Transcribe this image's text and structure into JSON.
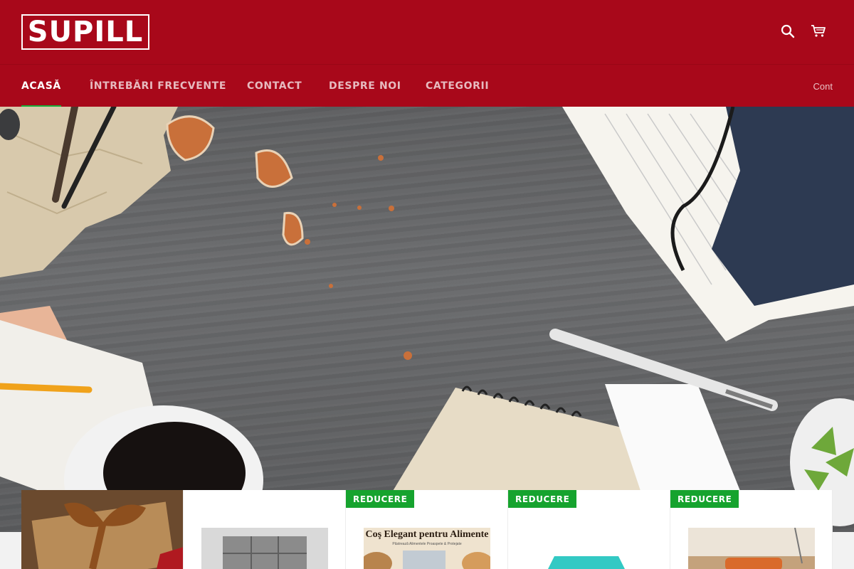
{
  "header": {
    "logo_text": "SUPILL",
    "icons": [
      "search-icon",
      "cart-icon"
    ],
    "brand_color": "#a8081a"
  },
  "nav": {
    "items": [
      {
        "label": "ACASĂ",
        "active": true
      },
      {
        "label": "ÎNTREBĂRI FRECVENTE",
        "active": false
      },
      {
        "label": "CONTACT",
        "active": false
      },
      {
        "label": "DESPRE NOI",
        "active": false
      },
      {
        "label": "CATEGORII",
        "active": false
      }
    ],
    "account_label": "Cont",
    "active_indicator_color": "#1aae3a"
  },
  "products": [
    {
      "badge": null,
      "image": "gift-box-with-ribbon"
    },
    {
      "badge": null,
      "image": "gray-storage-organizer"
    },
    {
      "badge": "REDUCERE",
      "image": "food-basket",
      "image_title": "Coş Elegant pentru Alimente",
      "image_subtitle": "Păstrează Alimentele Proaspete & Protejate"
    },
    {
      "badge": "REDUCERE",
      "image": "turquoise-item"
    },
    {
      "badge": "REDUCERE",
      "image": "wooden-desk-item"
    }
  ],
  "badge_color": "#16a32e"
}
